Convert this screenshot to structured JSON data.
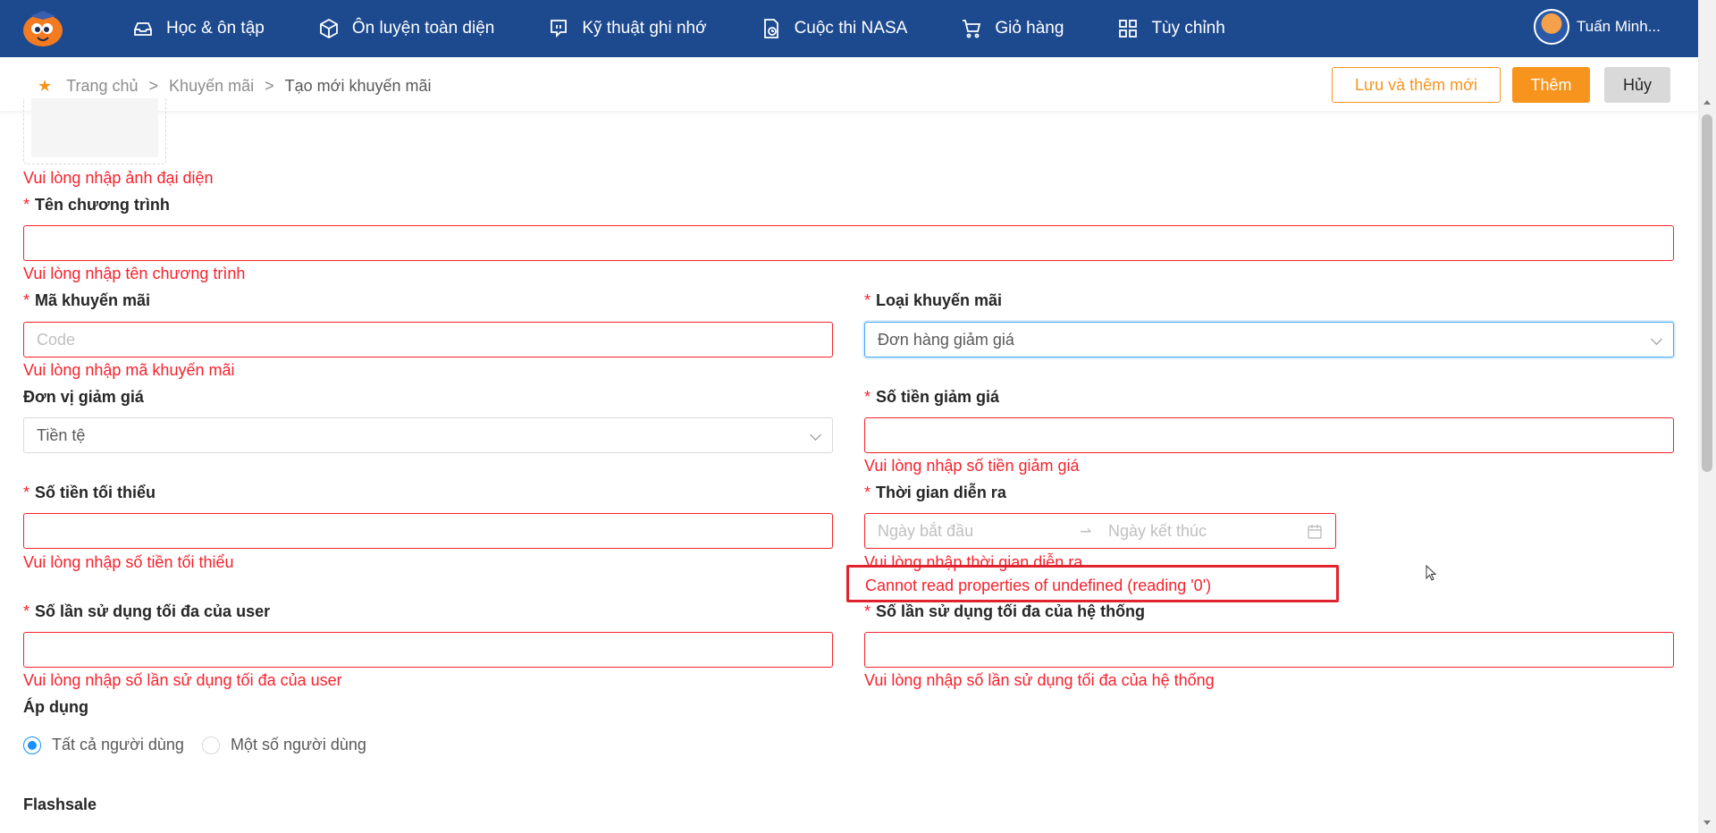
{
  "nav": {
    "items": [
      {
        "label": "Học & ôn tập",
        "icon": "inbox-icon"
      },
      {
        "label": "Ôn luyện toàn diện",
        "icon": "cube-icon"
      },
      {
        "label": "Kỹ thuật ghi nhớ",
        "icon": "chat-icon"
      },
      {
        "label": "Cuộc thi NASA",
        "icon": "document-clock-icon"
      },
      {
        "label": "Giỏ hàng",
        "icon": "cart-icon"
      },
      {
        "label": "Tùy chỉnh",
        "icon": "grid-icon"
      }
    ],
    "user_name": "Tuấn Minh..."
  },
  "breadcrumb": {
    "home": "Trang chủ",
    "section": "Khuyến mãi",
    "current": "Tạo mới khuyến mãi",
    "separator": ">"
  },
  "actions": {
    "save_and_add": "Lưu và thêm mới",
    "add": "Thêm",
    "cancel": "Hủy"
  },
  "form": {
    "avatar_error": "Vui lòng nhập ảnh đại diện",
    "program_name": {
      "label": "Tên chương trình",
      "value": "",
      "error": "Vui lòng nhập tên chương trình"
    },
    "promo_code": {
      "label": "Mã khuyến mãi",
      "placeholder": "Code",
      "error": "Vui lòng nhập mã khuyến mãi"
    },
    "promo_type": {
      "label": "Loại khuyến mãi",
      "value": "Đơn hàng giảm giá"
    },
    "discount_unit": {
      "label": "Đơn vị giảm giá",
      "value": "Tiền tệ"
    },
    "discount_amount": {
      "label": "Số tiền giảm giá",
      "value": "",
      "error": "Vui lòng nhập số tiền giảm giá"
    },
    "min_amount": {
      "label": "Số tiền tối thiểu",
      "value": "",
      "error": "Vui lòng nhập số tiền tối thiểu"
    },
    "duration": {
      "label": "Thời gian diễn ra",
      "start_placeholder": "Ngày bắt đầu",
      "end_placeholder": "Ngày kết thúc",
      "error": "Vui lòng nhập thời gian diễn ra"
    },
    "runtime_error": "Cannot read properties of undefined (reading '0')",
    "max_user_usage": {
      "label": "Số lần sử dụng tối đa của user",
      "value": "",
      "error": "Vui lòng nhập số lần sử dụng tối đa của user"
    },
    "max_system_usage": {
      "label": "Số lần sử dụng tối đa của hệ thống",
      "value": "",
      "error": "Vui lòng nhập số lần sử dụng tối đa của hệ thống"
    },
    "apply": {
      "label": "Áp dụng",
      "options": [
        "Tất cả người dùng",
        "Một số người dùng"
      ],
      "selected": "Tất cả người dùng"
    },
    "flashsale_label": "Flashsale"
  },
  "colors": {
    "topbar": "#1d4a8f",
    "accent": "#f7941d",
    "error": "#f5222d",
    "focus": "#40a9ff"
  }
}
